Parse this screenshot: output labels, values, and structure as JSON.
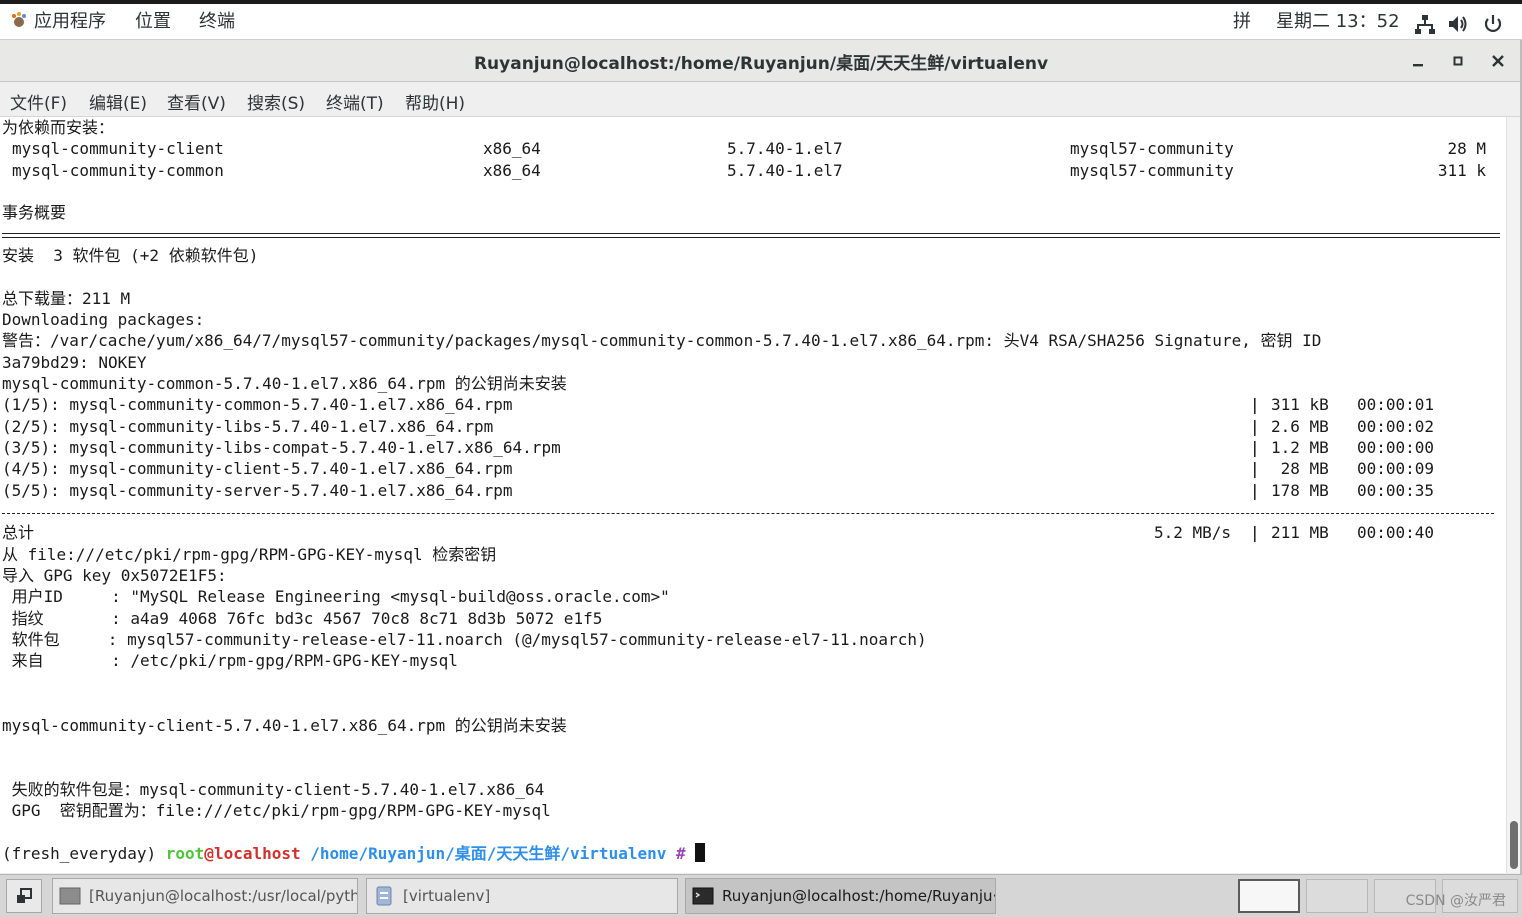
{
  "topbar": {
    "apps_label": "应用程序",
    "places_label": "位置",
    "terminal_label": "终端",
    "ime_label": "拼",
    "clock": "星期二 13：52",
    "icons": [
      "network-icon",
      "volume-icon",
      "power-icon"
    ]
  },
  "window": {
    "title": "Ruyanjun@localhost:/home/Ruyanjun/桌面/天天生鲜/virtualenv",
    "buttons": [
      "minimize-icon",
      "maximize-icon",
      "close-icon"
    ]
  },
  "menubar": {
    "items": [
      "文件(F)",
      "编辑(E)",
      "查看(V)",
      "搜索(S)",
      "终端(T)",
      "帮助(H)"
    ]
  },
  "terminal": {
    "dep_header": "为依赖而安装：",
    "dep_rows": [
      {
        "name": "mysql-community-client",
        "arch": "x86_64",
        "version": "5.7.40-1.el7",
        "repo": "mysql57-community",
        "size": "28 M"
      },
      {
        "name": "mysql-community-common",
        "arch": "x86_64",
        "version": "5.7.40-1.el7",
        "repo": "mysql57-community",
        "size": "311 k"
      }
    ],
    "summary_header": "事务概要",
    "install_line": "安装  3 软件包 (+2 依赖软件包)",
    "total_download": "总下载量：211 M",
    "downloading": "Downloading packages:",
    "warning_1": "警告：/var/cache/yum/x86_64/7/mysql57-community/packages/mysql-community-common-5.7.40-1.el7.x86_64.rpm: 头V4 RSA/SHA256 Signature, 密钥 ID",
    "warning_2": "3a79bd29: NOKEY",
    "pubkey_not_installed_1": "mysql-community-common-5.7.40-1.el7.x86_64.rpm 的公钥尚未安装",
    "downloads": [
      {
        "name": "(1/5): mysql-community-common-5.7.40-1.el7.x86_64.rpm",
        "size": "311 kB",
        "time": "00:00:01"
      },
      {
        "name": "(2/5): mysql-community-libs-5.7.40-1.el7.x86_64.rpm",
        "size": "2.6 MB",
        "time": "00:00:02"
      },
      {
        "name": "(3/5): mysql-community-libs-compat-5.7.40-1.el7.x86_64.rpm",
        "size": "1.2 MB",
        "time": "00:00:00"
      },
      {
        "name": "(4/5): mysql-community-client-5.7.40-1.el7.x86_64.rpm",
        "size": " 28 MB",
        "time": "00:00:09"
      },
      {
        "name": "(5/5): mysql-community-server-5.7.40-1.el7.x86_64.rpm",
        "size": "178 MB",
        "time": "00:00:35"
      }
    ],
    "total_label": "总计",
    "total_speed": "5.2 MB/s",
    "total_size": "211 MB",
    "total_time": "00:00:40",
    "retrieve_key": "从 file:///etc/pki/rpm-gpg/RPM-GPG-KEY-mysql 检索密钥",
    "import_key": "导入 GPG key 0x5072E1F5:",
    "key_user": " 用户ID     : \"MySQL Release Engineering <mysql-build@oss.oracle.com>\"",
    "key_fingerprint": " 指纹       : a4a9 4068 76fc bd3c 4567 70c8 8c71 8d3b 5072 e1f5",
    "key_package": " 软件包     : mysql57-community-release-el7-11.noarch (@/mysql57-community-release-el7-11.noarch)",
    "key_from": " 来自       : /etc/pki/rpm-gpg/RPM-GPG-KEY-mysql",
    "pubkey_not_installed_2": "mysql-community-client-5.7.40-1.el7.x86_64.rpm 的公钥尚未安装",
    "failed_pkg": " 失败的软件包是：mysql-community-client-5.7.40-1.el7.x86_64",
    "gpg_config": " GPG  密钥配置为：file:///etc/pki/rpm-gpg/RPM-GPG-KEY-mysql",
    "prompt": {
      "env": "(fresh_everyday) ",
      "user": "root",
      "at": "@",
      "host": "localhost",
      "path": " /home/Ruyanjun/桌面/天天生鲜/virtualenv",
      "hash": " # "
    }
  },
  "taskbar": {
    "tasks": [
      "[Ruyanjun@localhost:/usr/local/pyth···",
      "[virtualenv]",
      "Ruyanjun@localhost:/home/Ruyanju···"
    ],
    "watermark": "CSDN @汝严君"
  }
}
